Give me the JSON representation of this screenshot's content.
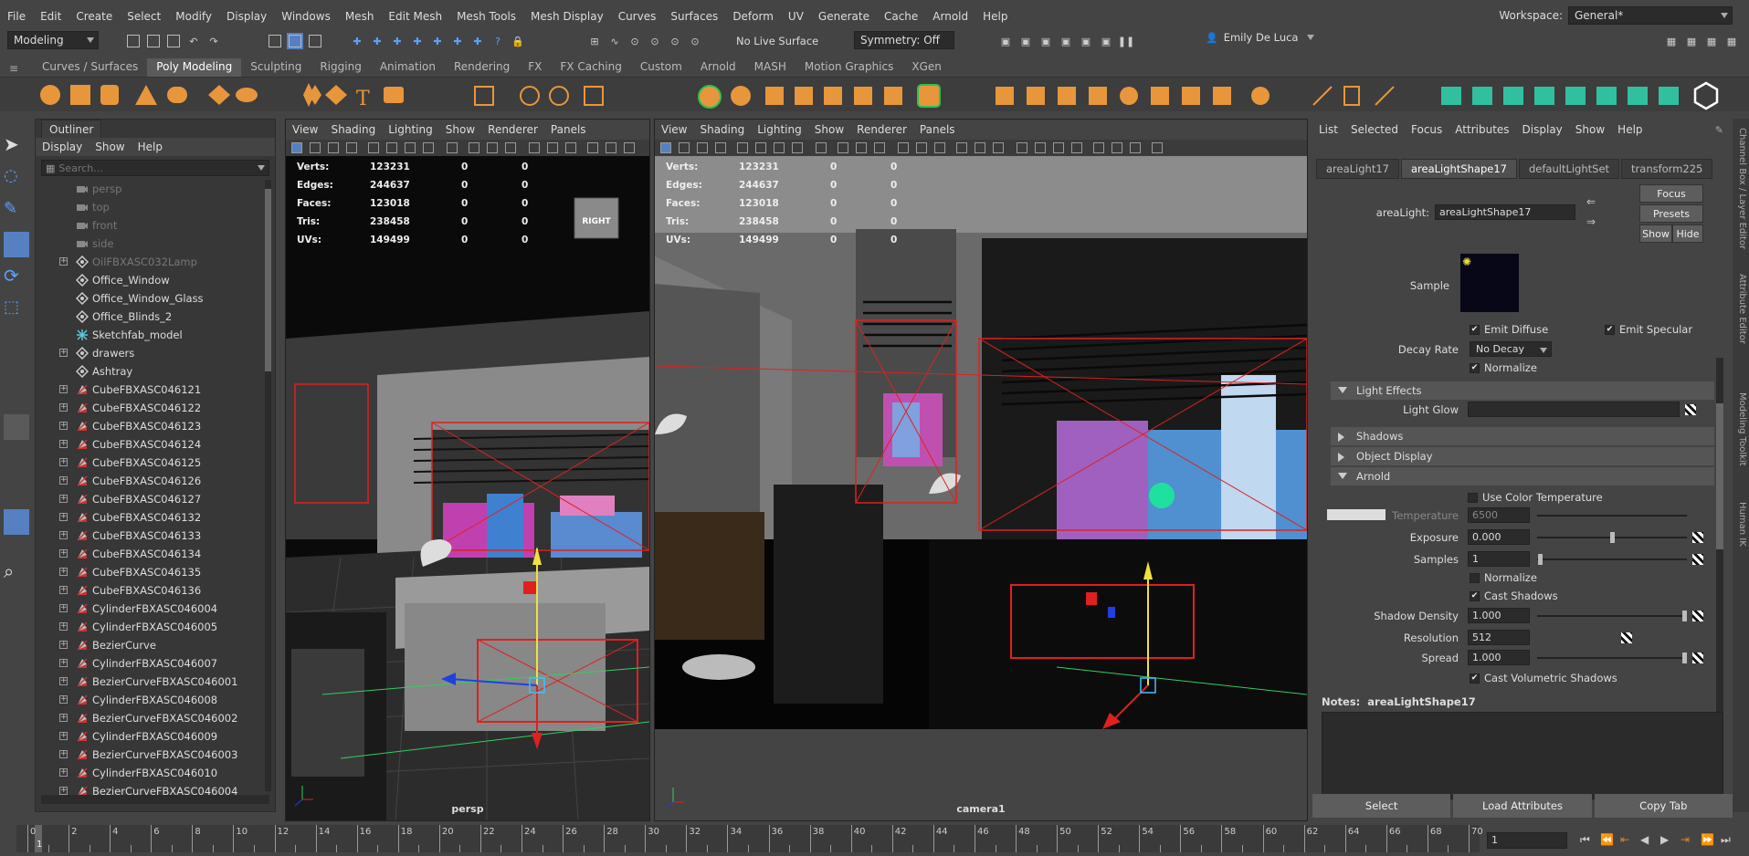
{
  "menubar": {
    "items": [
      "File",
      "Edit",
      "Create",
      "Select",
      "Modify",
      "Display",
      "Windows",
      "Mesh",
      "Edit Mesh",
      "Mesh Tools",
      "Mesh Display",
      "Curves",
      "Surfaces",
      "Deform",
      "UV",
      "Generate",
      "Cache",
      "Arnold",
      "Help"
    ],
    "workspace_label": "Workspace:",
    "workspace_value": "General*"
  },
  "statusline": {
    "mode": "Modeling",
    "live_surface": "No Live Surface",
    "symmetry": "Symmetry: Off",
    "user": "Emily De Luca"
  },
  "shelf": {
    "tabs": [
      "Curves / Surfaces",
      "Poly Modeling",
      "Sculpting",
      "Rigging",
      "Animation",
      "Rendering",
      "FX",
      "FX Caching",
      "Custom",
      "Arnold",
      "MASH",
      "Motion Graphics",
      "XGen"
    ],
    "active_tab": "Poly Modeling"
  },
  "outliner": {
    "title": "Outliner",
    "menu": [
      "Display",
      "Show",
      "Help"
    ],
    "search_placeholder": "Search...",
    "items": [
      {
        "label": "persp",
        "icon": "camera-icon",
        "dim": true,
        "expandable": false
      },
      {
        "label": "top",
        "icon": "camera-icon",
        "dim": true,
        "expandable": false
      },
      {
        "label": "front",
        "icon": "camera-icon",
        "dim": true,
        "expandable": false
      },
      {
        "label": "side",
        "icon": "camera-icon",
        "dim": true,
        "expandable": false
      },
      {
        "label": "OilFBXASC032Lamp",
        "icon": "transform-icon",
        "dim": true,
        "expandable": true
      },
      {
        "label": "Office_Window",
        "icon": "transform-icon",
        "dim": false,
        "expandable": false
      },
      {
        "label": "Office_Window_Glass",
        "icon": "transform-icon",
        "dim": false,
        "expandable": false
      },
      {
        "label": "Office_Blinds_2",
        "icon": "transform-icon",
        "dim": false,
        "expandable": false
      },
      {
        "label": "Sketchfab_model",
        "icon": "joint-icon",
        "dim": false,
        "expandable": false
      },
      {
        "label": "drawers",
        "icon": "transform-icon",
        "dim": false,
        "expandable": true
      },
      {
        "label": "Ashtray",
        "icon": "transform-icon",
        "dim": false,
        "expandable": false
      },
      {
        "label": "CubeFBXASC046121",
        "icon": "mesh-icon",
        "dim": false,
        "expandable": true
      },
      {
        "label": "CubeFBXASC046122",
        "icon": "mesh-icon",
        "dim": false,
        "expandable": true
      },
      {
        "label": "CubeFBXASC046123",
        "icon": "mesh-icon",
        "dim": false,
        "expandable": true
      },
      {
        "label": "CubeFBXASC046124",
        "icon": "mesh-icon",
        "dim": false,
        "expandable": true
      },
      {
        "label": "CubeFBXASC046125",
        "icon": "mesh-icon",
        "dim": false,
        "expandable": true
      },
      {
        "label": "CubeFBXASC046126",
        "icon": "mesh-icon",
        "dim": false,
        "expandable": true
      },
      {
        "label": "CubeFBXASC046127",
        "icon": "mesh-icon",
        "dim": false,
        "expandable": true
      },
      {
        "label": "CubeFBXASC046132",
        "icon": "mesh-icon",
        "dim": false,
        "expandable": true
      },
      {
        "label": "CubeFBXASC046133",
        "icon": "mesh-icon",
        "dim": false,
        "expandable": true
      },
      {
        "label": "CubeFBXASC046134",
        "icon": "mesh-icon",
        "dim": false,
        "expandable": true
      },
      {
        "label": "CubeFBXASC046135",
        "icon": "mesh-icon",
        "dim": false,
        "expandable": true
      },
      {
        "label": "CubeFBXASC046136",
        "icon": "mesh-icon",
        "dim": false,
        "expandable": true
      },
      {
        "label": "CylinderFBXASC046004",
        "icon": "mesh-icon",
        "dim": false,
        "expandable": true
      },
      {
        "label": "CylinderFBXASC046005",
        "icon": "mesh-icon",
        "dim": false,
        "expandable": true
      },
      {
        "label": "BezierCurve",
        "icon": "mesh-icon",
        "dim": false,
        "expandable": true
      },
      {
        "label": "CylinderFBXASC046007",
        "icon": "mesh-icon",
        "dim": false,
        "expandable": true
      },
      {
        "label": "BezierCurveFBXASC046001",
        "icon": "mesh-icon",
        "dim": false,
        "expandable": true
      },
      {
        "label": "CylinderFBXASC046008",
        "icon": "mesh-icon",
        "dim": false,
        "expandable": true
      },
      {
        "label": "BezierCurveFBXASC046002",
        "icon": "mesh-icon",
        "dim": false,
        "expandable": true
      },
      {
        "label": "CylinderFBXASC046009",
        "icon": "mesh-icon",
        "dim": false,
        "expandable": true
      },
      {
        "label": "BezierCurveFBXASC046003",
        "icon": "mesh-icon",
        "dim": false,
        "expandable": true
      },
      {
        "label": "CylinderFBXASC046010",
        "icon": "mesh-icon",
        "dim": false,
        "expandable": true
      },
      {
        "label": "BezierCurveFBXASC046004",
        "icon": "mesh-icon",
        "dim": false,
        "expandable": true
      }
    ]
  },
  "viewport_left": {
    "menu": [
      "View",
      "Shading",
      "Lighting",
      "Show",
      "Renderer",
      "Panels"
    ],
    "label": "persp",
    "cube_label": "RIGHT"
  },
  "viewport_right": {
    "menu": [
      "View",
      "Shading",
      "Lighting",
      "Show",
      "Renderer",
      "Panels"
    ],
    "label": "camera1"
  },
  "hud": [
    {
      "key": "Verts:",
      "v1": "123231",
      "v2": "0",
      "v3": "0"
    },
    {
      "key": "Edges:",
      "v1": "244637",
      "v2": "0",
      "v3": "0"
    },
    {
      "key": "Faces:",
      "v1": "123018",
      "v2": "0",
      "v3": "0"
    },
    {
      "key": "Tris:",
      "v1": "238458",
      "v2": "0",
      "v3": "0"
    },
    {
      "key": "UVs:",
      "v1": "149499",
      "v2": "0",
      "v3": "0"
    }
  ],
  "attr": {
    "menu": [
      "List",
      "Selected",
      "Focus",
      "Attributes",
      "Display",
      "Show",
      "Help"
    ],
    "tabs": [
      "areaLight17",
      "areaLightShape17",
      "defaultLightSet",
      "transform225"
    ],
    "active_tab": "areaLightShape17",
    "node_label": "areaLight:",
    "node_value": "areaLightShape17",
    "focus_btn": "Focus",
    "presets_btn": "Presets",
    "show_btn": "Show",
    "hide_btn": "Hide",
    "sample_label": "Sample",
    "emit_diffuse": "Emit Diffuse",
    "emit_specular": "Emit Specular",
    "decay_label": "Decay Rate",
    "decay_value": "No Decay",
    "normalize": "Normalize",
    "light_effects": "Light Effects",
    "light_glow": "Light Glow",
    "shadows": "Shadows",
    "object_display": "Object Display",
    "arnold": "Arnold",
    "use_color_temp": "Use Color Temperature",
    "temperature_label": "Temperature",
    "temperature_value": "6500",
    "exposure_label": "Exposure",
    "exposure_value": "0.000",
    "exposure_level": 0.5,
    "samples_label": "Samples",
    "samples_value": "1",
    "samples_level": 0.02,
    "normalize2": "Normalize",
    "cast_shadows": "Cast Shadows",
    "shadow_density_label": "Shadow Density",
    "shadow_density_value": "1.000",
    "shadow_density_level": 1.0,
    "resolution_label": "Resolution",
    "resolution_value": "512",
    "spread_label": "Spread",
    "spread_value": "1.000",
    "spread_level": 1.0,
    "cast_volumetric": "Cast Volumetric Shadows",
    "notes_label": "Notes:",
    "notes_value": "areaLightShape17",
    "bottom_buttons": [
      "Select",
      "Load Attributes",
      "Copy Tab"
    ]
  },
  "side_tabs": [
    "Channel Box / Layer Editor",
    "Attribute Editor",
    "Modeling Toolkit",
    "Human IK"
  ],
  "timeline": {
    "ticks": [
      "0",
      "2",
      "4",
      "6",
      "8",
      "10",
      "12",
      "14",
      "16",
      "18",
      "20",
      "22",
      "24",
      "26",
      "28",
      "30",
      "32",
      "34",
      "36",
      "38",
      "40",
      "42",
      "44",
      "46",
      "48",
      "50",
      "52",
      "54",
      "56",
      "58",
      "60",
      "62",
      "64",
      "66",
      "68",
      "70"
    ],
    "start": 0,
    "end": 70,
    "current_frame": "1",
    "current_frame_label": "1"
  },
  "colors": {
    "accent_active_tab": "#5a5a5a",
    "selection_red": "#e02020",
    "axis_green": "#30d060",
    "axis_blue": "#2040e0",
    "axis_yellow": "#f0e040",
    "city_magenta": "#d040c0",
    "city_cyan": "#40a0e0"
  }
}
